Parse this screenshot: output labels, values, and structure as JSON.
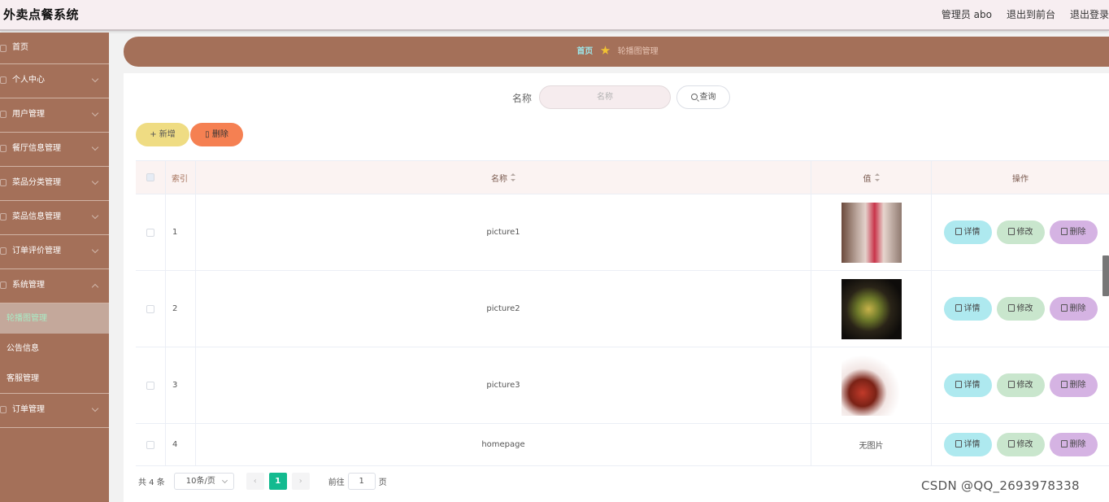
{
  "header": {
    "app_title": "外卖点餐系统",
    "links": [
      "管理员 abo",
      "退出到前台",
      "退出登录"
    ]
  },
  "sidebar": {
    "items": [
      {
        "label": "首页",
        "expandable": false
      },
      {
        "label": "个人中心",
        "expandable": true
      },
      {
        "label": "用户管理",
        "expandable": true
      },
      {
        "label": "餐厅信息管理",
        "expandable": true
      },
      {
        "label": "菜品分类管理",
        "expandable": true
      },
      {
        "label": "菜品信息管理",
        "expandable": true
      },
      {
        "label": "订单评价管理",
        "expandable": true
      },
      {
        "label": "系统管理",
        "expandable": true,
        "expanded": true
      }
    ],
    "sub_items": [
      {
        "label": "轮播图管理",
        "active": true
      },
      {
        "label": "公告信息",
        "active": false
      },
      {
        "label": "客服管理",
        "active": false
      }
    ],
    "last_item": {
      "label": "订单管理",
      "expandable": true
    }
  },
  "breadcrumb": {
    "home": "首页",
    "current": "轮播图管理"
  },
  "search": {
    "label": "名称",
    "placeholder": "名称",
    "button": "查询"
  },
  "actions": {
    "add": "新增",
    "delete": "删除"
  },
  "table": {
    "columns": {
      "index": "索引",
      "name": "名称",
      "value": "值",
      "ops": "操作"
    },
    "rows": [
      {
        "index": "1",
        "name": "picture1",
        "value": "",
        "has_image": true
      },
      {
        "index": "2",
        "name": "picture2",
        "value": "",
        "has_image": true
      },
      {
        "index": "3",
        "name": "picture3",
        "value": "",
        "has_image": true
      },
      {
        "index": "4",
        "name": "homepage",
        "value": "无图片",
        "has_image": false
      }
    ],
    "row_ops": {
      "detail": "详情",
      "edit": "修改",
      "remove": "删除"
    }
  },
  "pagination": {
    "total": "共 4 条",
    "page_size": "10条/页",
    "prev": "‹",
    "current": "1",
    "next": "›",
    "goto_label": "前往",
    "goto_value": "1",
    "page_suffix": "页"
  },
  "watermark": "CSDN @QQ_2693978338",
  "colors": {
    "sidebar": "#a47059",
    "breadcrumb_bar": "#a47059",
    "add_button": "#efdc83",
    "delete_button": "#f58052",
    "detail_button": "#aee9ef",
    "edit_button": "#c9e6cd",
    "remove_button": "#d5b3e3",
    "pager_active": "#13ba8f"
  }
}
